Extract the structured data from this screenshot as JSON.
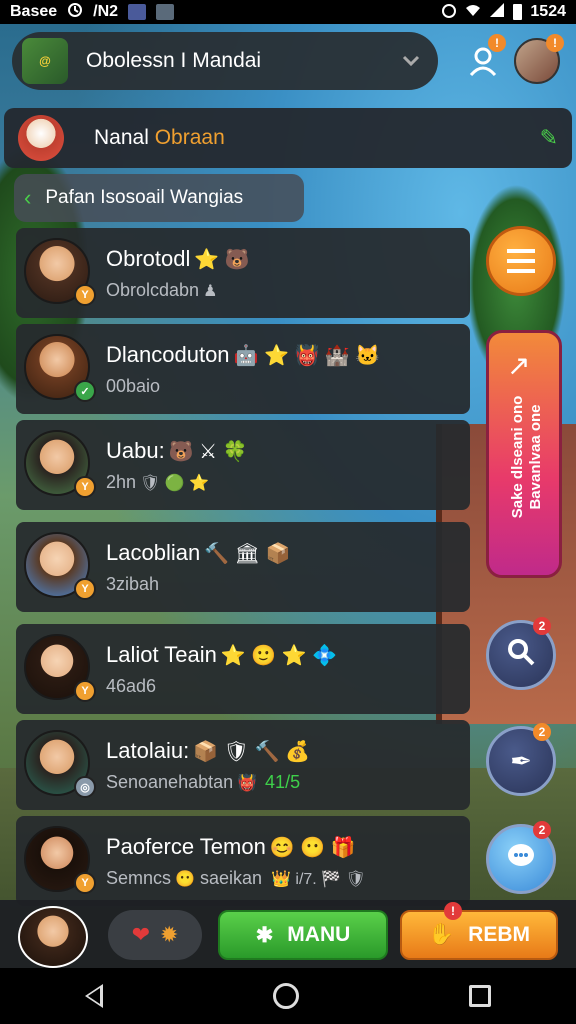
{
  "status_bar": {
    "carrier": "Basee",
    "network_label": "/N2",
    "time": "1524"
  },
  "header": {
    "title": "Obolessn I Mandai",
    "game_tag": "@"
  },
  "channel": {
    "name_prefix": "Nanal",
    "name_highlight": "Obraan"
  },
  "breadcrumb": {
    "label": "Pafan Isosoail Wangias"
  },
  "contacts": [
    {
      "name": "Obrotodl",
      "sub": "Obrolcdabn",
      "name_emoji": "⭐ 🐻",
      "sub_emoji": "♟",
      "badge": "Y",
      "badge_color": "orange"
    },
    {
      "name": "Dlancoduton",
      "sub": "00baio",
      "name_emoji": "🤖 ⭐ 👹 🏰 🐱",
      "sub_emoji": "",
      "badge": "✓",
      "badge_color": "green"
    },
    {
      "name": "Uabu:",
      "sub": "2hn",
      "name_emoji": "🐻 ⚔ 🍀",
      "sub_emoji": "🛡 🟢 ⭐",
      "badge": "Y",
      "badge_color": "orange"
    },
    {
      "name": "Lacoblian",
      "sub": "3zibah",
      "name_emoji": "🔨 🏛 📦",
      "sub_emoji": "",
      "badge": "Y",
      "badge_color": "orange"
    },
    {
      "name": "Laliot Teain",
      "sub": "46ad6",
      "name_emoji": "⭐ 🙂 ⭐ 💠",
      "sub_emoji": "",
      "badge": "Y",
      "badge_color": "orange"
    },
    {
      "name": "Latolaiu:",
      "sub": "Senoanehabtan",
      "name_emoji": "📦 🛡 🔨 💰",
      "sub_emoji": "👹",
      "sub_extra": "41/5",
      "badge": "◎",
      "badge_color": "grey"
    },
    {
      "name": "Paoferce Temon",
      "sub": "Semncs",
      "sub_after": "saeikan",
      "name_emoji": "😊 😶 🎁",
      "sub_emoji": "😶",
      "sub_tail": "👑 i/7. 🏁 🛡",
      "badge": "Y",
      "badge_color": "orange"
    }
  ],
  "side": {
    "banner_text_line1": "Sake dlseani ono",
    "banner_text_line2": "Bavanlvaa one",
    "search_badge": "2",
    "edit_badge": "2",
    "chat_badge": "2"
  },
  "header_badges": {
    "friend_badge": "!"
  },
  "bottom": {
    "main_label": "MANU",
    "reply_label": "REBM",
    "reply_badge": "!"
  },
  "colors": {
    "accent_green": "#3aa64a",
    "accent_orange": "#f0a030",
    "highlight_text": "#f0a030"
  }
}
